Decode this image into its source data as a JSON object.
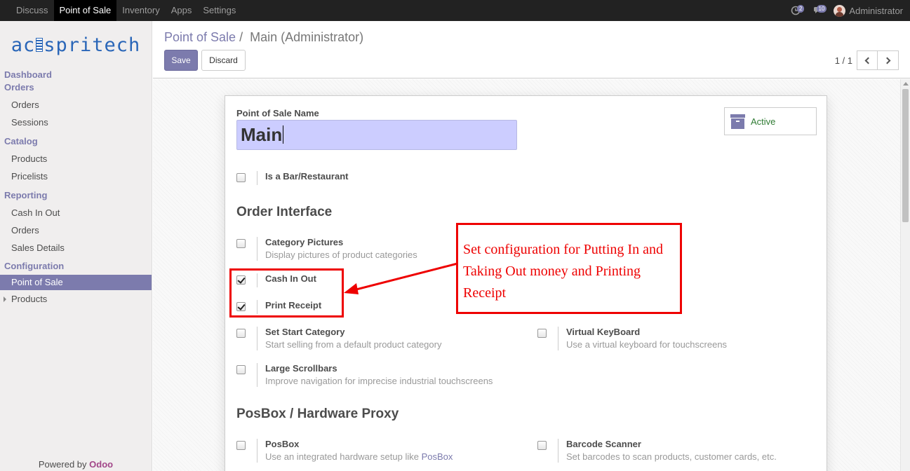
{
  "topbar": {
    "menu": [
      "Discuss",
      "Point of Sale",
      "Inventory",
      "Apps",
      "Settings"
    ],
    "active": "Point of Sale",
    "activity_count": "2",
    "message_count": "10",
    "user": "Administrator"
  },
  "sidebar": {
    "logo": {
      "left": "ac",
      "right": "spritech"
    },
    "dashboard": "Dashboard",
    "orders_head": "Orders",
    "orders_items": [
      "Orders",
      "Sessions"
    ],
    "catalog_head": "Catalog",
    "catalog_items": [
      "Products",
      "Pricelists"
    ],
    "reporting_head": "Reporting",
    "reporting_items": [
      "Cash In Out",
      "Orders",
      "Sales Details"
    ],
    "config_head": "Configuration",
    "config_items": [
      "Point of Sale",
      "Products"
    ],
    "powered_prefix": "Powered by ",
    "powered_brand": "Odoo"
  },
  "control": {
    "breadcrumb_link": "Point of Sale",
    "breadcrumb_sep": "/",
    "breadcrumb_current": "Main (Administrator)",
    "save": "Save",
    "discard": "Discard",
    "pager": "1 / 1"
  },
  "form": {
    "name_label": "Point of Sale Name",
    "name_value": "Main",
    "active_label": "Active",
    "is_bar": {
      "title": "Is a Bar/Restaurant",
      "checked": false
    },
    "order_interface_title": "Order Interface",
    "category_pictures": {
      "title": "Category Pictures",
      "desc": "Display pictures of product categories",
      "checked": false
    },
    "cash_in_out": {
      "title": "Cash In Out",
      "checked": true
    },
    "print_receipt": {
      "title": "Print Receipt",
      "checked": true
    },
    "set_start_category": {
      "title": "Set Start Category",
      "desc": "Start selling from a default product category",
      "checked": false
    },
    "virtual_keyboard": {
      "title": "Virtual KeyBoard",
      "desc": "Use a virtual keyboard for touchscreens",
      "checked": false
    },
    "large_scrollbars": {
      "title": "Large Scrollbars",
      "desc": "Improve navigation for imprecise industrial touchscreens",
      "checked": false
    },
    "posbox_title": "PosBox / Hardware Proxy",
    "posbox": {
      "title": "PosBox",
      "desc_prefix": "Use an integrated hardware setup like ",
      "desc_link": "PosBox",
      "checked": false
    },
    "barcode_scanner": {
      "title": "Barcode Scanner",
      "desc": "Set barcodes to scan products, customer cards, etc.",
      "checked": false
    }
  },
  "annotation": {
    "callout": "Set configuration for Putting In and Taking Out money and Printing Receipt"
  },
  "colors": {
    "brand": "#7c7bad",
    "annotation": "#e00000",
    "active_green": "#2f7b33"
  }
}
